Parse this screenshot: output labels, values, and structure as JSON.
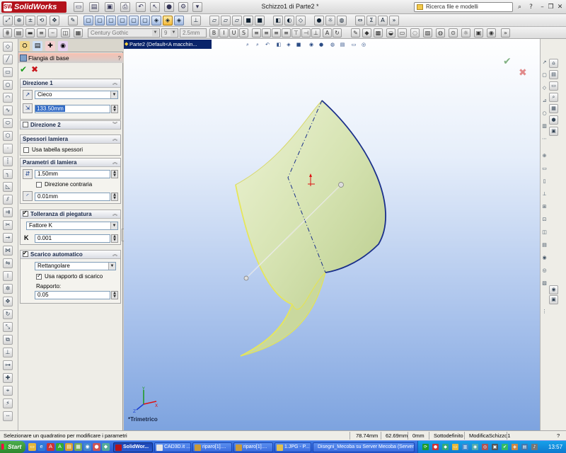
{
  "app": {
    "logo_text": "SolidWorks",
    "document_title": "Schizzo1 di Parte2 *",
    "search_placeholder": "Ricerca file e modelli"
  },
  "format_toolbar": {
    "font_name": "Century Gothic",
    "font_size": "9",
    "line_height": "2.5mm"
  },
  "property_manager": {
    "title": "Flangia di base",
    "help": "?",
    "direction1": {
      "header": "Direzione 1",
      "end_condition": "Cieco",
      "depth": "133.50mm"
    },
    "direction2": {
      "header": "Direzione 2"
    },
    "gauge": {
      "header": "Spessori lamiera",
      "use_table_label": "Usa tabella spessori"
    },
    "sheet_params": {
      "header": "Parametri di lamiera",
      "thickness": "1.50mm",
      "reverse_label": "Direzione contraria",
      "radius": "0.01mm"
    },
    "bend_allowance": {
      "header": "Tolleranza di piegatura",
      "type": "Fattore K",
      "k_label": "K",
      "k_value": "0.001"
    },
    "auto_relief": {
      "header": "Scarico automatico",
      "type": "Rettangolare",
      "use_ratio_label": "Usa rapporto di scarico",
      "ratio_label": "Rapporto:",
      "ratio_value": "0.05"
    }
  },
  "viewport": {
    "doc_tab": "Parte2  (Default<A macchin...",
    "view_name": "*Trimetrico"
  },
  "statusbar": {
    "message": "Selezionare un quadratino per modificare i parametri",
    "x": "78.74mm",
    "y": "62.69mm",
    "z": "0mm",
    "state": "Sottodefinito",
    "mode": "ModificaSchizzo1",
    "help": "?"
  },
  "taskbar": {
    "start": "Start",
    "tasks": [
      "SolidWor...",
      "CAD3D.it ...",
      "riparo[1]....",
      "riparo[1]....",
      "1.JPG - P...",
      "Disegni_Mecoba su Server Mecoba (Server"
    ],
    "clock": "13:57"
  },
  "colors": {
    "viewport_top": "#ffffff",
    "viewport_bottom": "#7da3df",
    "part_face": "#dfe9c0",
    "part_edge": "#e6e65a",
    "sketch_edge": "#1a2f8a",
    "taskbar": "#2456d0",
    "logo": "#b3121b"
  }
}
